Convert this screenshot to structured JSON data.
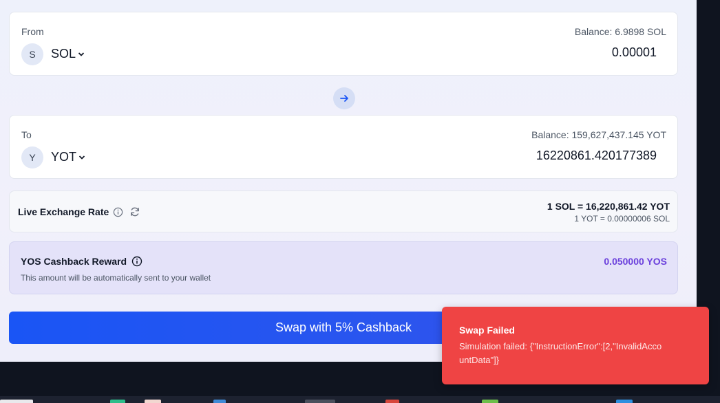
{
  "from": {
    "label": "From",
    "balance": "Balance: 6.9898 SOL",
    "token_initial": "S",
    "token": "SOL",
    "amount": "0.00001"
  },
  "to": {
    "label": "To",
    "balance": "Balance: 159,627,437.145 YOT",
    "token_initial": "Y",
    "token": "YOT",
    "amount": "16220861.420177389"
  },
  "rate": {
    "title": "Live Exchange Rate",
    "main": "1 SOL = 16,220,861.42 YOT",
    "inverse": "1 YOT = 0.00000006 SOL"
  },
  "cashback": {
    "title": "YOS Cashback Reward",
    "subtitle": "This amount will be automatically sent to your wallet",
    "value": "0.050000 YOS"
  },
  "swap_button_label": "Swap with 5% Cashback",
  "toast": {
    "title": "Swap Failed",
    "message": "Simulation failed: {\"InstructionError\":[2,\"InvalidAccountData\"]}"
  },
  "icons": {
    "swap_direction": "arrow-right-icon",
    "info": "info-icon",
    "refresh": "refresh-icon",
    "dropdown": "chevron-down-icon"
  },
  "colors": {
    "accent": "#1a55f5",
    "cashback_value": "#6a3fdc",
    "toast_background": "#ef4444"
  }
}
